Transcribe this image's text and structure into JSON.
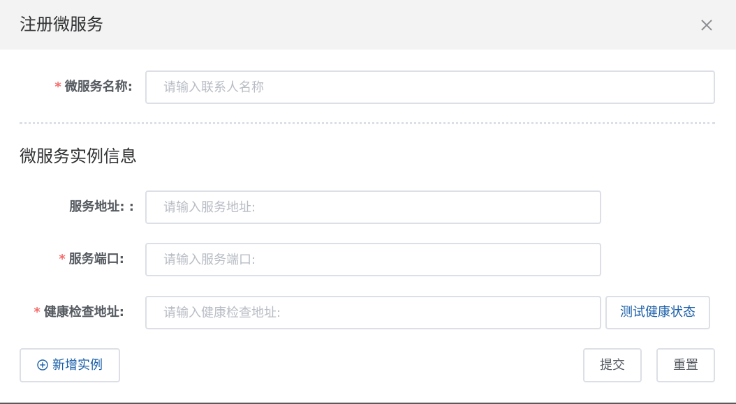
{
  "dialog": {
    "title": "注册微服务",
    "close_icon": "close-icon"
  },
  "service_name": {
    "required": "*",
    "label": "微服务名称:",
    "placeholder": "请输入联系人名称",
    "value": ""
  },
  "instance_section": {
    "title": "微服务实例信息"
  },
  "service_address": {
    "label": "服务地址: :",
    "placeholder": "请输入服务地址:",
    "value": ""
  },
  "service_port": {
    "required": "*",
    "label": "服务端口:",
    "placeholder": "请输入服务端口:",
    "value": ""
  },
  "health_check": {
    "required": "*",
    "label": "健康检查地址:",
    "placeholder": "请输入健康检查地址:",
    "value": "",
    "test_button_label": "测试健康状态"
  },
  "actions": {
    "add_instance_icon": "plus-circle-icon",
    "add_instance_label": "新增实例",
    "submit_label": "提交",
    "reset_label": "重置"
  },
  "colors": {
    "required": "#f56c6c",
    "link_blue": "#1a5fa8",
    "header_bg": "#f3f3f3",
    "border": "#dcdfe6"
  }
}
